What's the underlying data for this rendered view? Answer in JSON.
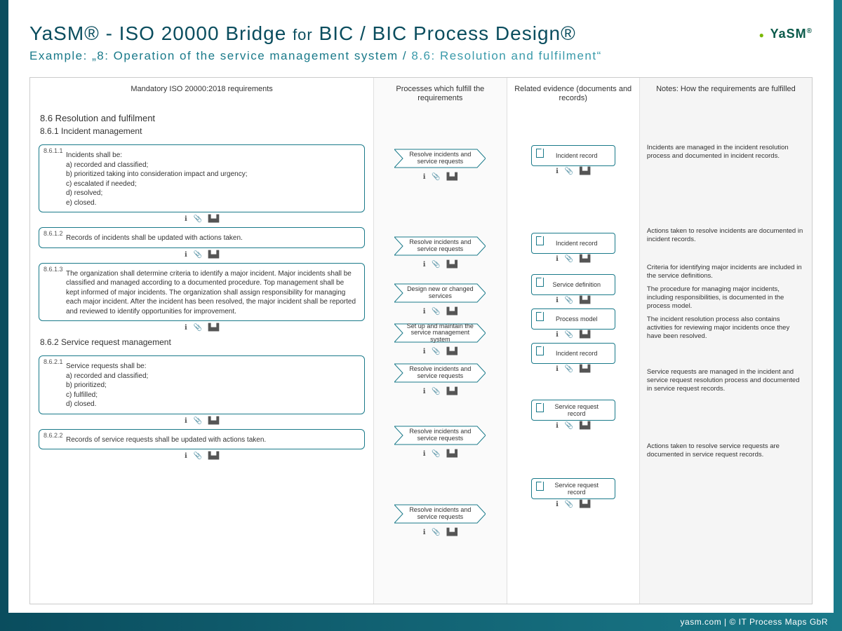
{
  "header": {
    "title_left": "YaSM® - ISO 20000 Bridge",
    "title_for": "for",
    "title_right": "BIC / BIC Process Design®",
    "logo_text": "YaSM",
    "logo_reg": "®",
    "subtitle_prefix": "Example:",
    "subtitle_main": "„8: Operation of the service management system /",
    "subtitle_light": "8.6: Resolution and fulfilment“"
  },
  "columns": [
    "Mandatory ISO 20000:2018 requirements",
    "Processes which fulfill the requirements",
    "Related evidence (documents and records)",
    "Notes: How the requirements are fulfilled"
  ],
  "section": "8.6 Resolution and fulfilment",
  "sub1": "8.6.1 Incident management",
  "sub2": "8.6.2 Service request management",
  "rows": [
    {
      "num": "8.6.1.1",
      "req": "Incidents shall be:\na) recorded and classified;\nb) prioritized taking into consideration impact and urgency;\nc) escalated if needed;\nd) resolved;\ne) closed.",
      "procs": [
        "Resolve incidents and service requests"
      ],
      "docs": [
        "Incident record"
      ],
      "note": [
        "Incidents are managed in the incident resolution process and documented in incident records."
      ]
    },
    {
      "num": "8.6.1.2",
      "req": "Records of incidents shall be updated with actions taken.",
      "procs": [
        "Resolve incidents and service requests"
      ],
      "docs": [
        "Incident record"
      ],
      "note": [
        "Actions taken to resolve incidents are documented in incident records."
      ]
    },
    {
      "num": "8.6.1.3",
      "req": "The organization shall determine criteria to identify a major incident. Major incidents shall be classified and managed according to a documented procedure. Top management shall be kept informed of major incidents. The organization shall assign responsibility for managing each major incident. After the incident has been resolved, the major incident shall be reported and reviewed to identify opportunities for improvement.",
      "procs": [
        "Design new or changed services",
        "Set up and maintain the service management system",
        "Resolve incidents and service requests"
      ],
      "docs": [
        "Service definition",
        "Process model",
        "Incident record"
      ],
      "note": [
        "Criteria for identifying major incidents are included in the service definitions.",
        "The procedure for managing major incidents, including responsibilities, is documented in the process model.",
        "The incident resolution process also contains activities for reviewing major incidents once they have been resolved."
      ]
    },
    {
      "num": "8.6.2.1",
      "req": "Service requests shall be:\na) recorded and classified;\nb) prioritized;\nc) fulfilled;\nd) closed.",
      "procs": [
        "Resolve incidents and service requests"
      ],
      "docs": [
        "Service request record"
      ],
      "note": [
        "Service requests are managed in the incident and service request resolution process and documented in service request records."
      ]
    },
    {
      "num": "8.6.2.2",
      "req": "Records of service requests shall be updated with actions taken.",
      "procs": [
        "Resolve incidents and service requests"
      ],
      "docs": [
        "Service request record"
      ],
      "note": [
        "Actions taken to resolve service requests are documented in service request records."
      ]
    }
  ],
  "icons": {
    "info": "i",
    "attach": "📎",
    "tree": "⮱"
  },
  "footer": "yasm.com | © IT Process Maps GbR"
}
